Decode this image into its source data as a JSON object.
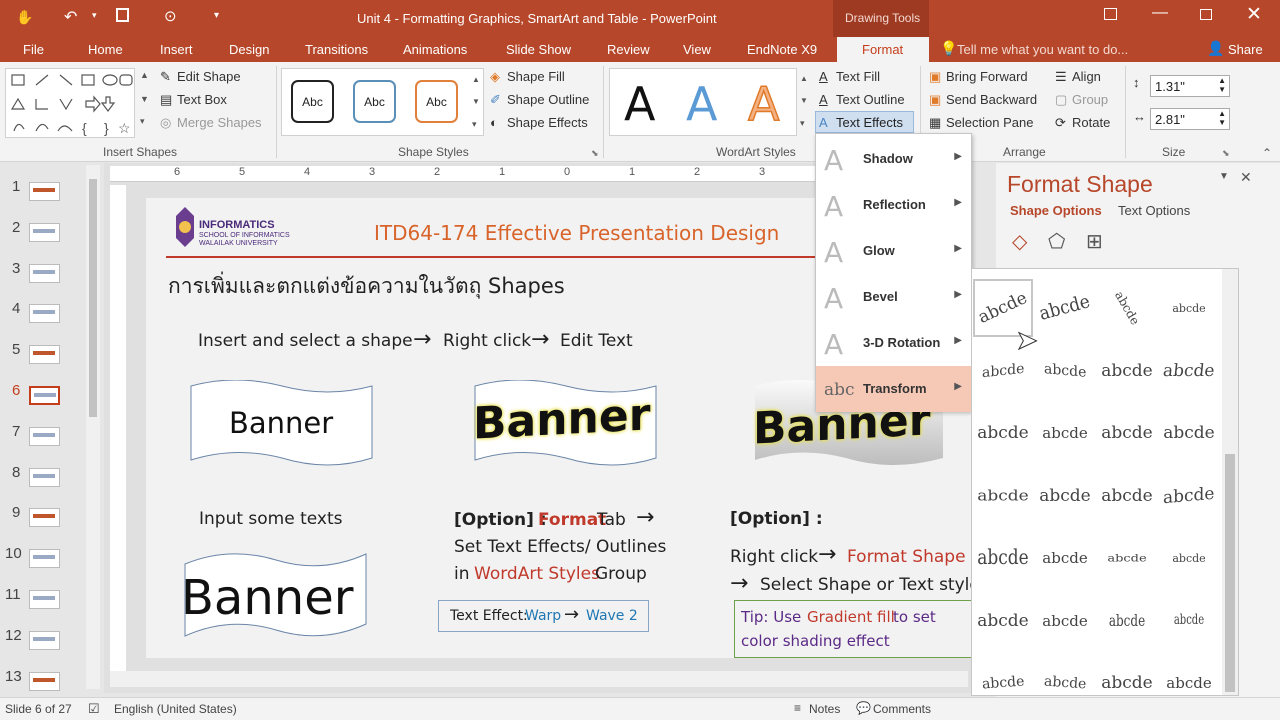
{
  "window": {
    "title": "Unit 4 - Formatting Graphics, SmartArt and Table - PowerPoint",
    "context_tab": "Drawing Tools"
  },
  "tabs": [
    "File",
    "Home",
    "Insert",
    "Design",
    "Transitions",
    "Animations",
    "Slide Show",
    "Review",
    "View",
    "EndNote X9",
    "Format"
  ],
  "tell_me": "Tell me what you want to do...",
  "share": "Share",
  "ribbon": {
    "insert_shapes": {
      "label": "Insert Shapes",
      "edit_shape": "Edit Shape",
      "text_box": "Text Box",
      "merge_shapes": "Merge Shapes"
    },
    "shape_styles": {
      "label": "Shape Styles",
      "sample": "Abc",
      "fill": "Shape Fill",
      "outline": "Shape Outline",
      "effects": "Shape Effects"
    },
    "wordart": {
      "label": "WordArt Styles",
      "sample": "A",
      "text_fill": "Text Fill",
      "text_outline": "Text Outline",
      "text_effects": "Text Effects"
    },
    "arrange": {
      "label": "Arrange",
      "bring_forward": "Bring Forward",
      "send_backward": "Send Backward",
      "selection_pane": "Selection Pane",
      "align": "Align",
      "group": "Group",
      "rotate": "Rotate"
    },
    "size": {
      "label": "Size",
      "height": "1.31\"",
      "width": "2.81\""
    }
  },
  "ruler": [
    "6",
    "5",
    "4",
    "3",
    "2",
    "1",
    "0",
    "1",
    "2",
    "3"
  ],
  "thumbs": [
    "1",
    "2",
    "3",
    "4",
    "5",
    "6",
    "7",
    "8",
    "9",
    "10",
    "11",
    "12",
    "13"
  ],
  "slide": {
    "logo_main": "INFORMATICS",
    "logo_sub1": "SCHOOL OF INFORMATICS",
    "logo_sub2": "WALAILAK UNIVERSITY",
    "course": "ITD64-174 Effective Presentation Design",
    "thai_title": "การเพิ่มและตกแต่งข้อความในวัตถุ Shapes",
    "step1": "Insert and select a shape",
    "step2": "Right click",
    "step3": "Edit Text",
    "arrow": "→",
    "banner": "Banner",
    "input_texts": "Input some texts",
    "opt1_a": "[Option] : ",
    "opt1_b": "Format",
    "opt1_c": " Tab",
    "opt1_line2": "Set Text Effects/ Outlines",
    "opt1_line3_a": "in ",
    "opt1_line3_b": "WordArt Styles",
    "opt1_line3_c": " Group",
    "effect_a": "Text Effect: ",
    "effect_b": "Warp",
    "effect_c": "Wave 2",
    "opt2_a": "[Option] :",
    "opt2_b": "Right click",
    "opt2_c": "Format Shape",
    "opt2_d": "Select Shape or Text style",
    "tip_a": "Tip: Use ",
    "tip_b": "Gradient fill",
    "tip_c": " to set",
    "tip_d": "color shading effect"
  },
  "text_effects_menu": [
    {
      "icon": "A",
      "label": "Shadow"
    },
    {
      "icon": "A",
      "label": "Reflection"
    },
    {
      "icon": "A",
      "label": "Glow"
    },
    {
      "icon": "A",
      "label": "Bevel"
    },
    {
      "icon": "A",
      "label": "3-D Rotation"
    },
    {
      "icon": "abc",
      "label": "Transform"
    }
  ],
  "pane": {
    "title": "Format Shape",
    "tab_shape": "Shape Options",
    "tab_text": "Text Options"
  },
  "gallery_sample": "abcde",
  "status": {
    "slide": "Slide 6 of 27",
    "language": "English (United States)",
    "notes": "Notes",
    "comments": "Comments"
  },
  "colors": {
    "accent": "#b7472a",
    "slide_red": "#c0392b",
    "link_blue": "#1f77b4",
    "format_tab": "#c43e1c"
  }
}
